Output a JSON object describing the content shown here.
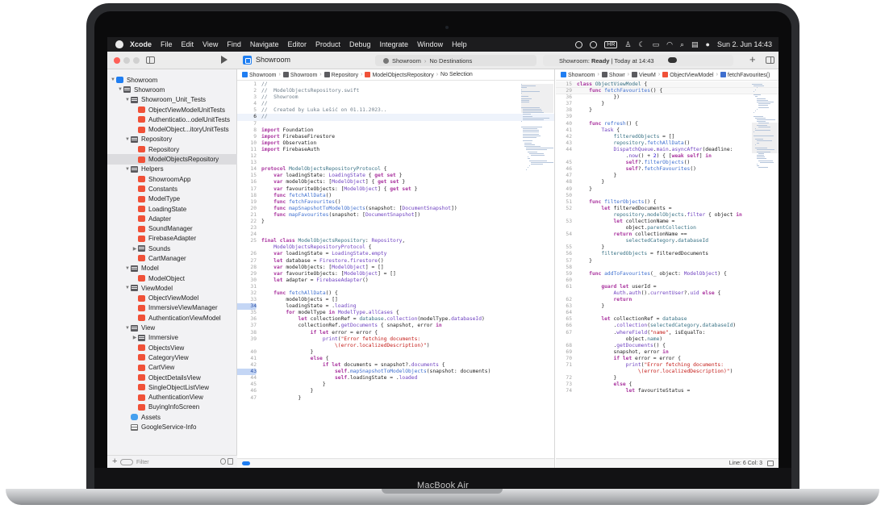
{
  "device": {
    "label": "MacBook Air"
  },
  "menubar": {
    "app": "Xcode",
    "items": [
      "File",
      "Edit",
      "View",
      "Find",
      "Navigate",
      "Editor",
      "Product",
      "Debug",
      "Integrate",
      "Window",
      "Help"
    ],
    "status_badge": "HR",
    "clock": "Sun 2. Jun  14:43"
  },
  "toolbar": {
    "project": "Showroom",
    "scheme": "Showroom",
    "destination": "No Destinations",
    "status_prefix": "Showroom:",
    "status_state": "Ready",
    "status_time": "| Today at 14:43",
    "add_label": "+"
  },
  "navigator": {
    "filter_placeholder": "Filter",
    "items": [
      {
        "label": "Showroom",
        "kind": "project",
        "depth": 0,
        "chevron": "open"
      },
      {
        "label": "Showroom",
        "kind": "folder",
        "depth": 1,
        "chevron": "open"
      },
      {
        "label": "Showroom_Unit_Tests",
        "kind": "folder",
        "depth": 2,
        "chevron": "open"
      },
      {
        "label": "ObjectViewModelUnitTests",
        "kind": "swift",
        "depth": 3
      },
      {
        "label": "Authenticatio...odelUnitTests",
        "kind": "swift",
        "depth": 3
      },
      {
        "label": "ModelObject...itoryUnitTests",
        "kind": "swift",
        "depth": 3
      },
      {
        "label": "Repository",
        "kind": "folder",
        "depth": 2,
        "chevron": "open"
      },
      {
        "label": "Repository",
        "kind": "swift",
        "depth": 3
      },
      {
        "label": "ModelObjectsRepository",
        "kind": "swift",
        "depth": 3,
        "selected": true
      },
      {
        "label": "Helpers",
        "kind": "folder",
        "depth": 2,
        "chevron": "open"
      },
      {
        "label": "ShowroomApp",
        "kind": "swift",
        "depth": 3
      },
      {
        "label": "Constants",
        "kind": "swift",
        "depth": 3
      },
      {
        "label": "ModelType",
        "kind": "swift",
        "depth": 3
      },
      {
        "label": "LoadingState",
        "kind": "swift",
        "depth": 3
      },
      {
        "label": "Adapter",
        "kind": "swift",
        "depth": 3
      },
      {
        "label": "SoundManager",
        "kind": "swift",
        "depth": 3
      },
      {
        "label": "FirebaseAdapter",
        "kind": "swift",
        "depth": 3
      },
      {
        "label": "Sounds",
        "kind": "folder",
        "depth": 3,
        "chevron": "closed"
      },
      {
        "label": "CartManager",
        "kind": "swift",
        "depth": 3
      },
      {
        "label": "Model",
        "kind": "folder",
        "depth": 2,
        "chevron": "open"
      },
      {
        "label": "ModelObject",
        "kind": "swift",
        "depth": 3
      },
      {
        "label": "ViewModel",
        "kind": "folder",
        "depth": 2,
        "chevron": "open"
      },
      {
        "label": "ObjectViewModel",
        "kind": "swift",
        "depth": 3
      },
      {
        "label": "ImmersiveViewManager",
        "kind": "swift",
        "depth": 3
      },
      {
        "label": "AuthenticationViewModel",
        "kind": "swift",
        "depth": 3
      },
      {
        "label": "View",
        "kind": "folder",
        "depth": 2,
        "chevron": "open"
      },
      {
        "label": "Immersive",
        "kind": "folder",
        "depth": 3,
        "chevron": "closed"
      },
      {
        "label": "ObjectsView",
        "kind": "swift",
        "depth": 3
      },
      {
        "label": "CategoryView",
        "kind": "swift",
        "depth": 3
      },
      {
        "label": "CartView",
        "kind": "swift",
        "depth": 3
      },
      {
        "label": "ObjectDetailsView",
        "kind": "swift",
        "depth": 3
      },
      {
        "label": "SingleObjectListView",
        "kind": "swift",
        "depth": 3
      },
      {
        "label": "AuthenticationView",
        "kind": "swift",
        "depth": 3
      },
      {
        "label": "BuyingInfoScreen",
        "kind": "swift",
        "depth": 3
      },
      {
        "label": "Assets",
        "kind": "assets",
        "depth": 2
      },
      {
        "label": "GoogleService-Info",
        "kind": "plist",
        "depth": 2
      }
    ]
  },
  "editor_left": {
    "jumpbar": [
      "Showroom",
      "Showroom",
      "Repository",
      "ModelObjectsRepository",
      "No Selection"
    ],
    "lines": [
      {
        "n": "1",
        "h": "<span class='c'>//</span>"
      },
      {
        "n": "2",
        "h": "<span class='c'>//  ModelObjectsRepository.swift</span>"
      },
      {
        "n": "3",
        "h": "<span class='c'>//  Showroom</span>"
      },
      {
        "n": "4",
        "h": "<span class='c'>//</span>"
      },
      {
        "n": "5",
        "h": "<span class='c'>//  Created by Luka Lešić on 01.11.2023..</span>"
      },
      {
        "n": "6",
        "h": "<span class='c'>//</span>",
        "current": true
      },
      {
        "n": "7",
        "h": ""
      },
      {
        "n": "8",
        "h": "<span class='k'>import</span> Foundation"
      },
      {
        "n": "9",
        "h": "<span class='k'>import</span> FirebaseFirestore"
      },
      {
        "n": "10",
        "h": "<span class='k'>import</span> Observation"
      },
      {
        "n": "11",
        "h": "<span class='k'>import</span> FirebaseAuth"
      },
      {
        "n": "12",
        "h": ""
      },
      {
        "n": "13",
        "h": ""
      },
      {
        "n": "14",
        "h": "<span class='k'>protocol</span> <span class='t'>ModelObjectsRepositoryProtocol</span> {"
      },
      {
        "n": "15",
        "h": "    <span class='k'>var</span> loadingState: <span class='p'>LoadingState</span> { <span class='k'>get set</span> }"
      },
      {
        "n": "16",
        "h": "    <span class='k'>var</span> modelObjects: [<span class='p'>ModelObject</span>] { <span class='k'>get set</span> }"
      },
      {
        "n": "17",
        "h": "    <span class='k'>var</span> favouriteObjects: [<span class='p'>ModelObject</span>] { <span class='k'>get set</span> }"
      },
      {
        "n": "18",
        "h": "    <span class='k'>func</span> <span class='f'>fetchAllData</span>()"
      },
      {
        "n": "19",
        "h": "    <span class='k'>func</span> <span class='f'>fetchFavourites</span>()"
      },
      {
        "n": "20",
        "h": "    <span class='k'>func</span> <span class='f'>mapSnapshotToModelObjects</span>(snapshot: [<span class='p'>DocumentSnapshot</span>])"
      },
      {
        "n": "21",
        "h": "    <span class='k'>func</span> <span class='f'>mapFavourites</span>(snapshot: [<span class='p'>DocumentSnapshot</span>])"
      },
      {
        "n": "22",
        "h": "}"
      },
      {
        "n": "23",
        "h": ""
      },
      {
        "n": "24",
        "h": ""
      },
      {
        "n": "25",
        "h": "<span class='k'>final class</span> <span class='t'>ModelObjectsRepository</span>: <span class='p'>Repository</span>,"
      },
      {
        "n": "",
        "h": "    <span class='p'>ModelObjectsRepositoryProtocol</span> {"
      },
      {
        "n": "26",
        "h": "    <span class='k'>var</span> loadingState = <span class='p'>LoadingState</span>.<span class='p'>empty</span>"
      },
      {
        "n": "27",
        "h": "    <span class='k'>let</span> database = <span class='p'>Firestore</span>.<span class='p'>firestore</span>()"
      },
      {
        "n": "28",
        "h": "    <span class='k'>var</span> modelObjects: [<span class='p'>ModelObject</span>] = []"
      },
      {
        "n": "29",
        "h": "    <span class='k'>var</span> favouriteObjects: [<span class='p'>ModelObject</span>] = []"
      },
      {
        "n": "30",
        "h": "    <span class='k'>let</span> adapter = <span class='p'>FirebaseAdapter</span>()"
      },
      {
        "n": "31",
        "h": ""
      },
      {
        "n": "32",
        "h": "    <span class='k'>func</span> <span class='f'>fetchAllData</span>() {"
      },
      {
        "n": "33",
        "h": "        modelObjects = []"
      },
      {
        "n": "34",
        "h": "        loadingState = .<span class='p'>loading</span>",
        "bp": true
      },
      {
        "n": "35",
        "h": "        <span class='k'>for</span> modelType <span class='k'>in</span> <span class='p'>ModelType</span>.<span class='p'>allCases</span> {"
      },
      {
        "n": "36",
        "h": "            <span class='k'>let</span> collectionRef = <span class='t'>database</span>.<span class='p'>collection</span>(modelType.<span class='p'>databaseId</span>)"
      },
      {
        "n": "37",
        "h": "            collectionRef.<span class='p'>getDocuments</span> { snapshot, error <span class='k'>in</span>"
      },
      {
        "n": "38",
        "h": "                <span class='k'>if let</span> error = error {"
      },
      {
        "n": "39",
        "h": "                    <span class='p'>print</span>(<span class='s'>\"Error fetching documents:</span>"
      },
      {
        "n": "",
        "h": "                        <span class='s'>\\(error.localizedDescription)\"</span>)"
      },
      {
        "n": "40",
        "h": "                }"
      },
      {
        "n": "41",
        "h": "                <span class='k'>else</span> {"
      },
      {
        "n": "42",
        "h": "                    <span class='k'>if let</span> documents = snapshot?.<span class='p'>documents</span> {"
      },
      {
        "n": "43",
        "h": "                        <span class='k'>self</span>.<span class='f'>mapSnapshotToModelObjects</span>(snapshot: documents)",
        "bp": true
      },
      {
        "n": "44",
        "h": "                        <span class='k'>self</span>.loadingState = .<span class='p'>loaded</span>"
      },
      {
        "n": "45",
        "h": "                    }"
      },
      {
        "n": "46",
        "h": "                }"
      },
      {
        "n": "47",
        "h": "            }"
      }
    ]
  },
  "editor_right": {
    "jumpbar": [
      "Showroom",
      "Showr",
      "ViewM",
      "ObjectViewModel",
      "fetchFavourites()"
    ],
    "lines": [
      {
        "n": "15",
        "h": "<span class='k'>class</span> <span class='t'>ObjectViewModel</span> {",
        "sticky": true
      },
      {
        "n": "29",
        "h": "    <span class='k'>func</span> <span class='f'>fetchFavourites</span>() {",
        "sticky": true
      },
      {
        "n": "36",
        "h": "            })"
      },
      {
        "n": "37",
        "h": "        }"
      },
      {
        "n": "38",
        "h": "    }"
      },
      {
        "n": "39",
        "h": ""
      },
      {
        "n": "40",
        "h": "    <span class='k'>func</span> <span class='f'>refresh</span>() {"
      },
      {
        "n": "41",
        "h": "        <span class='p'>Task</span> {"
      },
      {
        "n": "42",
        "h": "            <span class='t'>filteredObjects</span> = []"
      },
      {
        "n": "43",
        "h": "            <span class='t'>repository</span>.<span class='f'>fetchAllData</span>()"
      },
      {
        "n": "44",
        "h": "            <span class='p'>DispatchQueue</span>.<span class='p'>main</span>.<span class='p'>asyncAfter</span>(deadline:"
      },
      {
        "n": "",
        "h": "                .<span class='p'>now</span>() + <span class='n'>2</span>) { [<span class='k'>weak self</span>] <span class='k'>in</span>"
      },
      {
        "n": "45",
        "h": "                <span class='k'>self</span>?.<span class='f'>filterObjects</span>()"
      },
      {
        "n": "46",
        "h": "                <span class='k'>self</span>?.<span class='f'>fetchFavourites</span>()"
      },
      {
        "n": "47",
        "h": "            }"
      },
      {
        "n": "48",
        "h": "        }"
      },
      {
        "n": "49",
        "h": "    }"
      },
      {
        "n": "50",
        "h": ""
      },
      {
        "n": "51",
        "h": "    <span class='k'>func</span> <span class='f'>filterObjects</span>() {"
      },
      {
        "n": "52",
        "h": "        <span class='k'>let</span> filteredDocuments ="
      },
      {
        "n": "",
        "h": "            <span class='t'>repository</span>.<span class='t'>modelObjects</span>.<span class='p'>filter</span> { object <span class='k'>in</span>"
      },
      {
        "n": "53",
        "h": "            <span class='k'>let</span> collectionName ="
      },
      {
        "n": "",
        "h": "                object.<span class='t'>parentCollection</span>"
      },
      {
        "n": "54",
        "h": "            <span class='k'>return</span> collectionName =="
      },
      {
        "n": "",
        "h": "                <span class='t'>selectedCategory</span>.<span class='t'>databaseId</span>"
      },
      {
        "n": "55",
        "h": "        }"
      },
      {
        "n": "56",
        "h": "        <span class='t'>filteredObjects</span> = filteredDocuments"
      },
      {
        "n": "57",
        "h": "    }"
      },
      {
        "n": "58",
        "h": ""
      },
      {
        "n": "59",
        "h": "    <span class='k'>func</span> <span class='f'>addToFavourites</span>(_ object: <span class='p'>ModelObject</span>) {"
      },
      {
        "n": "60",
        "h": ""
      },
      {
        "n": "61",
        "h": "        <span class='k'>guard let</span> userId ="
      },
      {
        "n": "",
        "h": "            <span class='p'>Auth</span>.<span class='p'>auth</span>().<span class='p'>currentUser</span>?.<span class='p'>uid</span> <span class='k'>else</span> {"
      },
      {
        "n": "62",
        "h": "            <span class='k'>return</span>"
      },
      {
        "n": "63",
        "h": "        }"
      },
      {
        "n": "64",
        "h": ""
      },
      {
        "n": "65",
        "h": "        <span class='k'>let</span> collectionRef = <span class='t'>database</span>"
      },
      {
        "n": "66",
        "h": "            .<span class='p'>collection</span>(<span class='t'>selectedCategory</span>.<span class='t'>databaseId</span>)"
      },
      {
        "n": "67",
        "h": "            .<span class='p'>whereField</span>(<span class='s'>\"name\"</span>, isEqualTo:"
      },
      {
        "n": "",
        "h": "                object.<span class='t'>name</span>)"
      },
      {
        "n": "68",
        "h": "            .<span class='p'>getDocuments</span>() {"
      },
      {
        "n": "69",
        "h": "            snapshot, error <span class='k'>in</span>"
      },
      {
        "n": "70",
        "h": "            <span class='k'>if let</span> error = error {"
      },
      {
        "n": "71",
        "h": "                <span class='p'>print</span>(<span class='s'>\"Error fetching documents:</span>"
      },
      {
        "n": "",
        "h": "                    <span class='s'>\\(error.localizedDescription)\"</span>)"
      },
      {
        "n": "72",
        "h": "            }"
      },
      {
        "n": "73",
        "h": "            <span class='k'>else</span> {"
      },
      {
        "n": "74",
        "h": "                <span class='k'>let</span> favouriteStatus ="
      }
    ],
    "status": "Line: 6  Col: 3"
  },
  "colors": {
    "accent": "#1f7ef2",
    "swift_icon": "#f05138",
    "keyword": "#a9339e",
    "type": "#3a7386",
    "string": "#c41a16",
    "comment": "#707f8c"
  }
}
